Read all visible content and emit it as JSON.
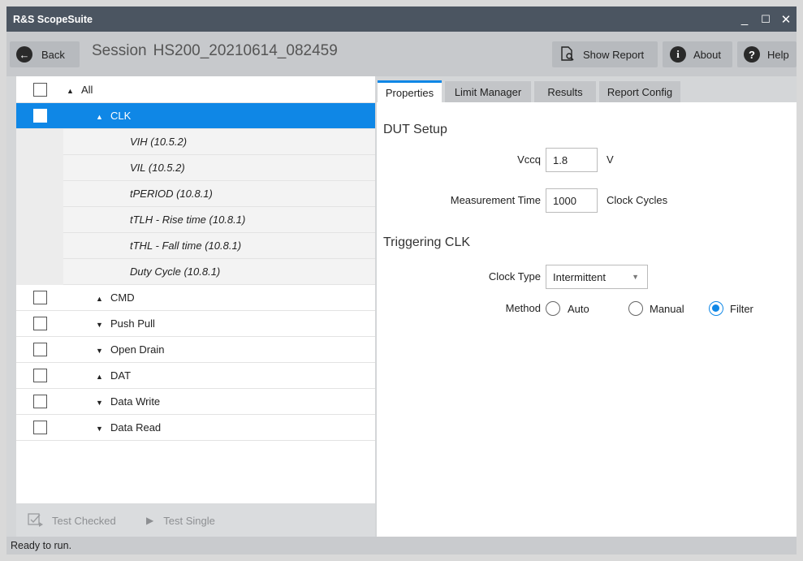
{
  "window": {
    "title": "R&S ScopeSuite"
  },
  "toolbar": {
    "back_label": "Back",
    "session_label": "Session",
    "session_name": "HS200_20210614_082459",
    "show_report_label": "Show Report",
    "about_label": "About",
    "help_label": "Help"
  },
  "tree": {
    "items": [
      {
        "label": "All",
        "level": 0,
        "expander": "up",
        "checkbox": true
      },
      {
        "label": "CLK",
        "level": 1,
        "expander": "up",
        "checkbox": true,
        "selected": true
      },
      {
        "label": "VIH (10.5.2)",
        "level": 2,
        "checkbox": false
      },
      {
        "label": "VIL (10.5.2)",
        "level": 2,
        "checkbox": false
      },
      {
        "label": "tPERIOD (10.8.1)",
        "level": 2,
        "checkbox": false
      },
      {
        "label": "tTLH - Rise time (10.8.1)",
        "level": 2,
        "checkbox": false
      },
      {
        "label": "tTHL - Fall time (10.8.1)",
        "level": 2,
        "checkbox": false
      },
      {
        "label": "Duty Cycle (10.8.1)",
        "level": 2,
        "checkbox": false
      },
      {
        "label": "CMD",
        "level": 1,
        "expander": "up",
        "checkbox": true
      },
      {
        "label": "Push Pull",
        "level": 1,
        "expander": "down",
        "checkbox": true
      },
      {
        "label": "Open Drain",
        "level": 1,
        "expander": "down",
        "checkbox": true
      },
      {
        "label": "DAT",
        "level": 1,
        "expander": "up",
        "checkbox": true
      },
      {
        "label": "Data Write",
        "level": 1,
        "expander": "down",
        "checkbox": true
      },
      {
        "label": "Data Read",
        "level": 1,
        "expander": "down",
        "checkbox": true
      }
    ]
  },
  "bottom": {
    "test_checked_label": "Test Checked",
    "test_single_label": "Test Single"
  },
  "tabs": [
    "Properties",
    "Limit Manager",
    "Results",
    "Report Config"
  ],
  "properties": {
    "dut_setup_title": "DUT Setup",
    "vccq_label": "Vccq",
    "vccq_value": "1.8",
    "vccq_unit": "V",
    "meas_time_label": "Measurement Time",
    "meas_time_value": "1000",
    "meas_time_unit": "Clock Cycles",
    "triggering_title": "Triggering CLK",
    "clock_type_label": "Clock Type",
    "clock_type_value": "Intermittent",
    "method_label": "Method",
    "method_options": [
      "Auto",
      "Manual",
      "Filter"
    ],
    "method_selected": "Filter"
  },
  "status": {
    "text": "Ready to run."
  },
  "colors": {
    "accent": "#0f87e6",
    "titlebar": "#4b5561"
  }
}
